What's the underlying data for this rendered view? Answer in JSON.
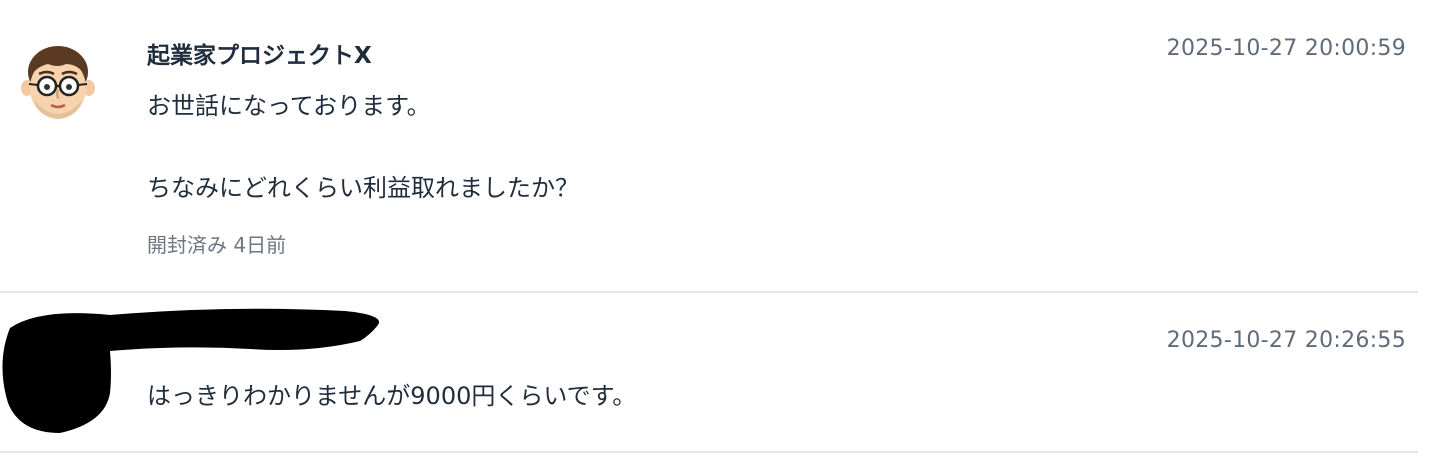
{
  "messages": [
    {
      "sender": "起業家プロジェクトX",
      "timestamp": "2025-10-27 20:00:59",
      "body": [
        "お世話になっております。",
        "ちなみにどれくらい利益取れましたか？"
      ],
      "read_status": "開封済み 4日前",
      "avatar_icon": "cartoon-man-with-glasses-icon"
    },
    {
      "sender_redacted": true,
      "timestamp": "2025-10-27 20:26:55",
      "body": [
        "はっきりわかりませんが9000円くらいです。"
      ]
    }
  ],
  "colors": {
    "divider": "#e3e5e8",
    "text": "#1f2d3d",
    "muted": "#5f6b78",
    "redaction": "#000000"
  }
}
